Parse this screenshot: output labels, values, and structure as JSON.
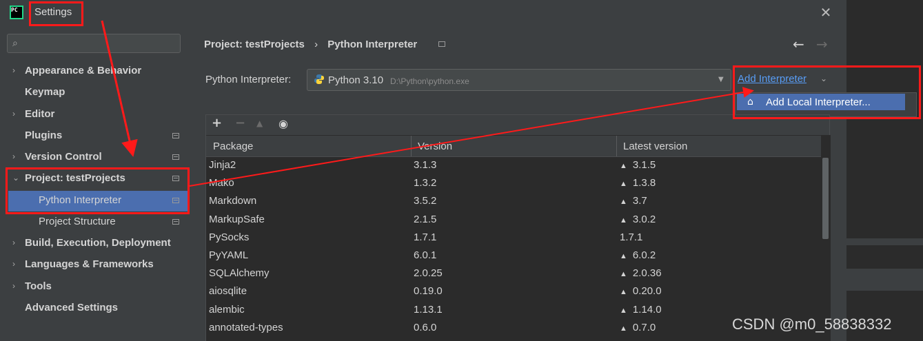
{
  "window": {
    "title": "Settings",
    "logo_text": "PC",
    "close_icon": "close-icon"
  },
  "sidebar": {
    "search_placeholder": "",
    "items": [
      {
        "label": "Appearance & Behavior",
        "expandable": true
      },
      {
        "label": "Keymap",
        "expandable": false
      },
      {
        "label": "Editor",
        "expandable": true
      },
      {
        "label": "Plugins",
        "expandable": false
      },
      {
        "label": "Version Control",
        "expandable": true
      },
      {
        "label": "Project: testProjects",
        "expandable": true,
        "expanded": true
      },
      {
        "label": "Python Interpreter",
        "child": true,
        "selected": true
      },
      {
        "label": "Project Structure",
        "child": true
      },
      {
        "label": "Build, Execution, Deployment",
        "expandable": true
      },
      {
        "label": "Languages & Frameworks",
        "expandable": true
      },
      {
        "label": "Tools",
        "expandable": true
      },
      {
        "label": "Advanced Settings",
        "expandable": false
      }
    ]
  },
  "breadcrumb": {
    "project": "Project: testProjects",
    "separator": "›",
    "page": "Python Interpreter"
  },
  "interpreter": {
    "label": "Python Interpreter:",
    "name": "Python 3.10",
    "path": "D:\\Python\\python.exe",
    "add_label": "Add Interpreter",
    "menu_item": "Add Local Interpreter..."
  },
  "toolbar": {
    "add": "+",
    "remove": "−",
    "upgrade": "▲",
    "eye": "◉"
  },
  "table": {
    "columns": [
      "Package",
      "Version",
      "Latest version"
    ],
    "rows": [
      {
        "package": "Jinja2",
        "version": "3.1.3",
        "latest": "3.1.5",
        "upgrade": true
      },
      {
        "package": "Mako",
        "version": "1.3.2",
        "latest": "1.3.8",
        "upgrade": true
      },
      {
        "package": "Markdown",
        "version": "3.5.2",
        "latest": "3.7",
        "upgrade": true
      },
      {
        "package": "MarkupSafe",
        "version": "2.1.5",
        "latest": "3.0.2",
        "upgrade": true
      },
      {
        "package": "PySocks",
        "version": "1.7.1",
        "latest": "1.7.1",
        "upgrade": false
      },
      {
        "package": "PyYAML",
        "version": "6.0.1",
        "latest": "6.0.2",
        "upgrade": true
      },
      {
        "package": "SQLAlchemy",
        "version": "2.0.25",
        "latest": "2.0.36",
        "upgrade": true
      },
      {
        "package": "aiosqlite",
        "version": "0.19.0",
        "latest": "0.20.0",
        "upgrade": true
      },
      {
        "package": "alembic",
        "version": "1.13.1",
        "latest": "1.14.0",
        "upgrade": true
      },
      {
        "package": "annotated-types",
        "version": "0.6.0",
        "latest": "0.7.0",
        "upgrade": true
      }
    ]
  },
  "watermark": "CSDN @m0_58838332",
  "colors": {
    "accent": "#4b6eaf",
    "link": "#589df6",
    "annotation": "#ff1a1a"
  }
}
